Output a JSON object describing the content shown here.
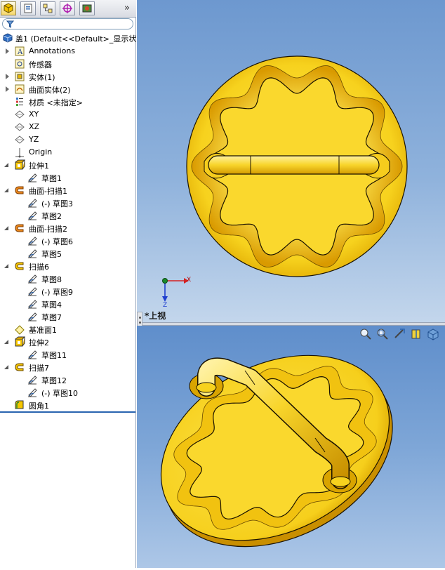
{
  "toolbar": {
    "tabs": [
      {
        "name": "feature-manager",
        "icon": "feature-tree-icon",
        "active": true
      },
      {
        "name": "property-manager",
        "icon": "property-icon",
        "active": false
      },
      {
        "name": "configuration-manager",
        "icon": "configuration-icon",
        "active": false
      },
      {
        "name": "dimxpert-manager",
        "icon": "dimxpert-icon",
        "active": false
      },
      {
        "name": "display-manager",
        "icon": "display-icon",
        "active": false
      }
    ],
    "more": "»"
  },
  "filter": {
    "icon": "filter-icon",
    "placeholder": ""
  },
  "tree": {
    "root": "盖1  (Default<<Default>_显示状态",
    "items": [
      {
        "label": "Annotations",
        "icon": "annotations-icon",
        "expander": "closed"
      },
      {
        "label": "传感器",
        "icon": "sensor-icon",
        "expander": "none"
      },
      {
        "label": "实体(1)",
        "icon": "solid-bodies-icon",
        "expander": "closed"
      },
      {
        "label": "曲面实体(2)",
        "icon": "surface-bodies-icon",
        "expander": "closed"
      },
      {
        "label": "材质 <未指定>",
        "icon": "material-icon",
        "expander": "none"
      },
      {
        "label": "XY",
        "icon": "plane-icon",
        "expander": "none"
      },
      {
        "label": "XZ",
        "icon": "plane-icon",
        "expander": "none"
      },
      {
        "label": "YZ",
        "icon": "plane-icon",
        "expander": "none"
      },
      {
        "label": "Origin",
        "icon": "origin-icon",
        "expander": "none"
      },
      {
        "label": "拉伸1",
        "icon": "extrude-icon",
        "expander": "open"
      },
      {
        "label": "草图1",
        "icon": "sketch-icon",
        "expander": "none",
        "child": true
      },
      {
        "label": "曲面-扫描1",
        "icon": "surface-sweep-icon",
        "expander": "open"
      },
      {
        "label": "(-) 草图3",
        "icon": "sketch-icon",
        "expander": "none",
        "child": true
      },
      {
        "label": "草图2",
        "icon": "sketch-icon",
        "expander": "none",
        "child": true
      },
      {
        "label": "曲面-扫描2",
        "icon": "surface-sweep-icon",
        "expander": "open"
      },
      {
        "label": "(-) 草图6",
        "icon": "sketch-icon",
        "expander": "none",
        "child": true
      },
      {
        "label": "草图5",
        "icon": "sketch-icon",
        "expander": "none",
        "child": true
      },
      {
        "label": "扫描6",
        "icon": "sweep-icon",
        "expander": "open"
      },
      {
        "label": "草图8",
        "icon": "sketch-icon",
        "expander": "none",
        "child": true
      },
      {
        "label": "(-) 草图9",
        "icon": "sketch-icon",
        "expander": "none",
        "child": true
      },
      {
        "label": "草图4",
        "icon": "sketch-icon",
        "expander": "none",
        "child": true
      },
      {
        "label": "草图7",
        "icon": "sketch-icon",
        "expander": "none",
        "child": true
      },
      {
        "label": "基准面1",
        "icon": "ref-plane-icon",
        "expander": "none"
      },
      {
        "label": "拉伸2",
        "icon": "extrude-icon",
        "expander": "open"
      },
      {
        "label": "草图11",
        "icon": "sketch-icon",
        "expander": "none",
        "child": true
      },
      {
        "label": "扫描7",
        "icon": "sweep-icon",
        "expander": "open"
      },
      {
        "label": "草图12",
        "icon": "sketch-icon",
        "expander": "none",
        "child": true
      },
      {
        "label": "(-) 草图10",
        "icon": "sketch-icon",
        "expander": "none",
        "child": true
      },
      {
        "label": "圆角1",
        "icon": "fillet-icon",
        "expander": "none"
      }
    ]
  },
  "viewport_top": {
    "view_label": "*上视",
    "triad": {
      "x": "X",
      "z": "Z"
    }
  },
  "viewport_iso": {
    "tools": [
      "zoom-to-fit-icon",
      "zoom-area-icon",
      "previous-view-icon",
      "section-view-icon",
      "view-orientation-icon"
    ]
  },
  "colors": {
    "part_yellow": "#f7d21e",
    "part_shadow": "#d79e00",
    "part_edge": "#1a1200",
    "viewport_top": "#6d98cf",
    "viewport_bottom": "#c3d6ec",
    "selection_blue": "#2a64b0"
  }
}
